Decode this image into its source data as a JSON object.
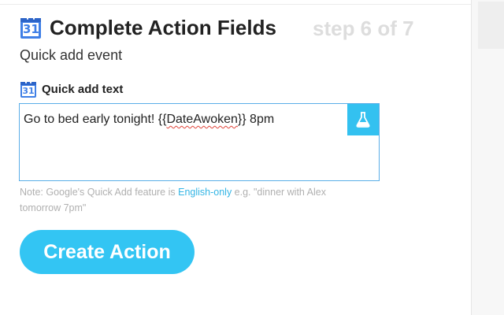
{
  "header": {
    "title": "Complete Action Fields",
    "step": "step 6 of 7",
    "calendar_icon_number": "31"
  },
  "action": {
    "subtitle": "Quick add event"
  },
  "field": {
    "label": "Quick add text",
    "calendar_icon_number": "31",
    "value_prefix": "Go to bed early tonight! {{",
    "value_ingredient": "DateAwoken",
    "value_suffix": "}} 8pm",
    "test_icon": "flask-icon"
  },
  "note": {
    "prefix": "Note: Google's Quick Add feature is ",
    "link": "English-only",
    "suffix": " e.g. \"dinner with Alex tomorrow 7pm\""
  },
  "create_button": {
    "label": "Create Action"
  },
  "colors": {
    "accent": "#33c5f3",
    "link": "#33b5e5",
    "calendar_blue": "#3f7fe6",
    "muted_text": "#b0b0b0",
    "step_text": "#dddddd"
  }
}
